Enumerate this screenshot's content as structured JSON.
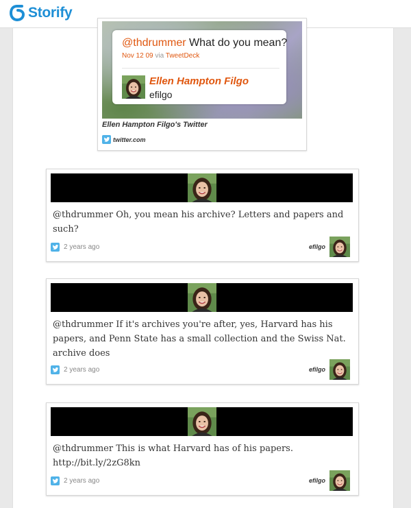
{
  "header": {
    "logo_text": "Storify",
    "brand_color": "#1e8fd6"
  },
  "embed": {
    "mention": "@thdrummer",
    "text": " What do you mean?",
    "date": "Nov 12 09",
    "via": "via",
    "client": "TweetDeck",
    "author_name": "Ellen Hampton Filgo",
    "author_handle": "efilgo",
    "caption": "Ellen Hampton Filgo's Twitter",
    "source": "twitter.com",
    "accent_color": "#e0570f"
  },
  "tweets": [
    {
      "text": "@thdrummer Oh, you mean his archive? Letters and papers and such?",
      "time": "2 years ago",
      "user": "efilgo"
    },
    {
      "text": "@thdrummer If it's archives you're after, yes, Harvard has his papers, and Penn State has a small collection and the Swiss Nat. archive does",
      "time": "2 years ago",
      "user": "efilgo"
    },
    {
      "text": "@thdrummer This is what Harvard has of his papers. http://bit.ly/2zG8kn",
      "time": "2 years ago",
      "user": "efilgo"
    }
  ],
  "icons": {
    "logo": "storify-logo-icon",
    "bird": "twitter-bird-icon",
    "avatar": "user-avatar-photo"
  }
}
